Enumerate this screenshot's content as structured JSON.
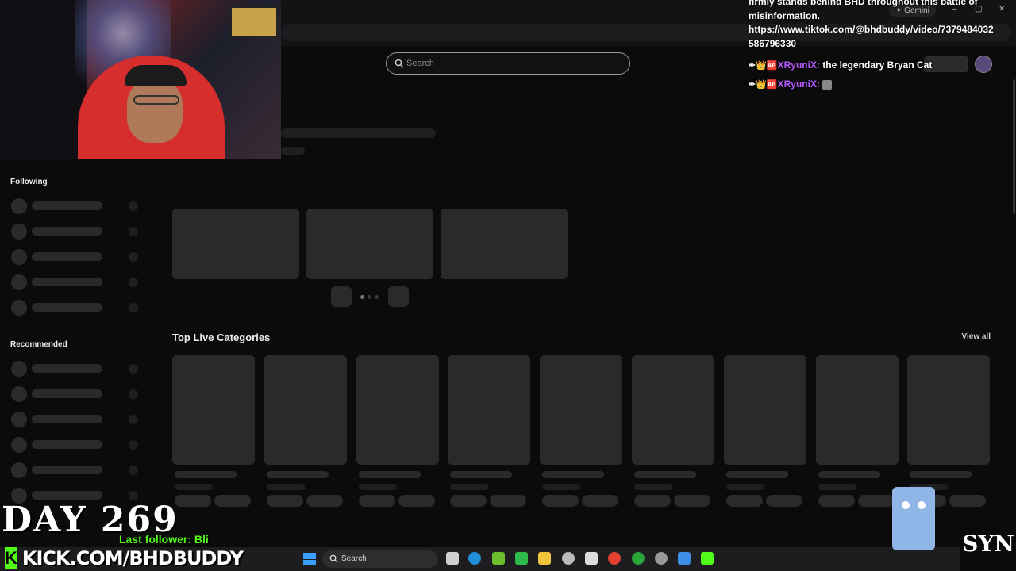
{
  "browser": {
    "gemini_label": "Gemini",
    "window_controls": [
      "–",
      "▢",
      "✕"
    ]
  },
  "site": {
    "search_placeholder": "Search",
    "sidebar": {
      "following_title": "Following",
      "recommended_title": "Recommended"
    },
    "top_live_categories": {
      "title": "Top Live Categories",
      "view_all": "View all"
    }
  },
  "chat": {
    "top_lines": [
      "firmly stands behind BHD throughout this battle of",
      "misinformation.",
      "https://www.tiktok.com/@bhdbuddy/video/7379484032",
      "586796330"
    ],
    "messages": [
      {
        "badges": "✒👑🆎",
        "username": "XRyuniX:",
        "text": "the legendary Bryan Cat"
      },
      {
        "badges": "✒👑🆎",
        "username": "XRyuniX:",
        "text": ""
      }
    ]
  },
  "overlay": {
    "day_counter": "DAY 269",
    "last_follower": "Last follower: Bli",
    "kick_url": "KICK.COM/BHDBUDDY",
    "kick_logo": "K",
    "corner_logo": "SYN"
  },
  "taskbar": {
    "search_label": "Search"
  },
  "colors": {
    "kick_green": "#53fc18",
    "username_purple": "#b65cff",
    "skeleton": "#2a2a2c",
    "background": "#0b0b0c"
  }
}
